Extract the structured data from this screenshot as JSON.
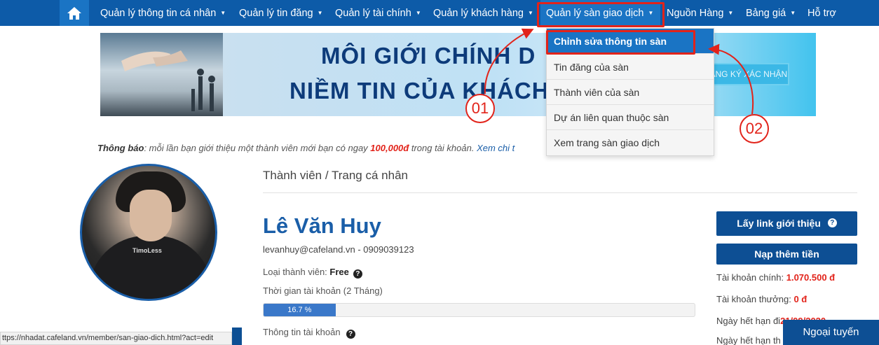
{
  "nav": {
    "home_icon": "home-icon",
    "items": [
      {
        "label": "Quản lý thông tin cá nhân"
      },
      {
        "label": "Quản lý tin đăng"
      },
      {
        "label": "Quản lý tài chính"
      },
      {
        "label": "Quản lý khách hàng"
      },
      {
        "label": "Quản lý sàn giao dịch"
      },
      {
        "label": "Nguồn Hàng"
      },
      {
        "label": "Bảng giá"
      },
      {
        "label": "Hỗ trợ"
      }
    ]
  },
  "banner": {
    "line1": "MÔI GIỚI CHÍNH D",
    "line2": "NIỀM TIN CỦA KHÁCH",
    "cta": "ĐĂNG KÝ XÁC NHẬN"
  },
  "dropdown": {
    "items": [
      {
        "label": "Chỉnh sửa thông tin sàn"
      },
      {
        "label": "Tin đăng của sàn"
      },
      {
        "label": "Thành viên của sàn"
      },
      {
        "label": "Dự án liên quan thuộc sàn"
      },
      {
        "label": "Xem trang sàn giao dịch"
      }
    ]
  },
  "annotations": {
    "step1": "01",
    "step2": "02",
    "highlight_color": "#e2231a"
  },
  "notice": {
    "label": "Thông báo",
    "text1": ": mỗi lần bạn giới thiệu một thành viên mới bạn có ngay ",
    "amount": "100,000đ",
    "text2": " trong tài khoản. ",
    "link": "Xem chi t"
  },
  "avatar": {
    "shirt_text": "TimoLess"
  },
  "breadcrumb": "Thành viên / Trang cá nhân",
  "profile": {
    "name": "Lê Văn Huy",
    "contact": "levanhuy@cafeland.vn - 0909039123",
    "member_type_label": "Loại thành viên: ",
    "member_type_value": "Free",
    "account_time": "Thời gian tài khoản (2 Tháng)",
    "progress_label": "16.7 %",
    "progress_value": 0.167,
    "account_info": "Thông tin tài khoản"
  },
  "sidebar": {
    "referral_button": "Lấy link giới thiệu",
    "topup_button": "Nạp thêm tiền",
    "main_account_label": "Tài khoản chính: ",
    "main_account_value": "1.070.500 đ",
    "bonus_account_label": "Tài khoản thưởng: ",
    "bonus_account_value": "0 đ",
    "expiry_label": "Ngày hết hạn đi",
    "expiry_value": "21/09/2020",
    "expiry2_label": "Ngày hết hạn th"
  },
  "status_bar": {
    "url": "ttps://nhadat.cafeland.vn/member/san-giao-dich.html?act=edit"
  },
  "chat": {
    "status": "Ngoại tuyến"
  },
  "colors": {
    "nav_bg": "#0d5ba8",
    "active_bg": "#1a74c4",
    "brand_dark": "#0d4f94",
    "accent_red": "#e2231a"
  }
}
